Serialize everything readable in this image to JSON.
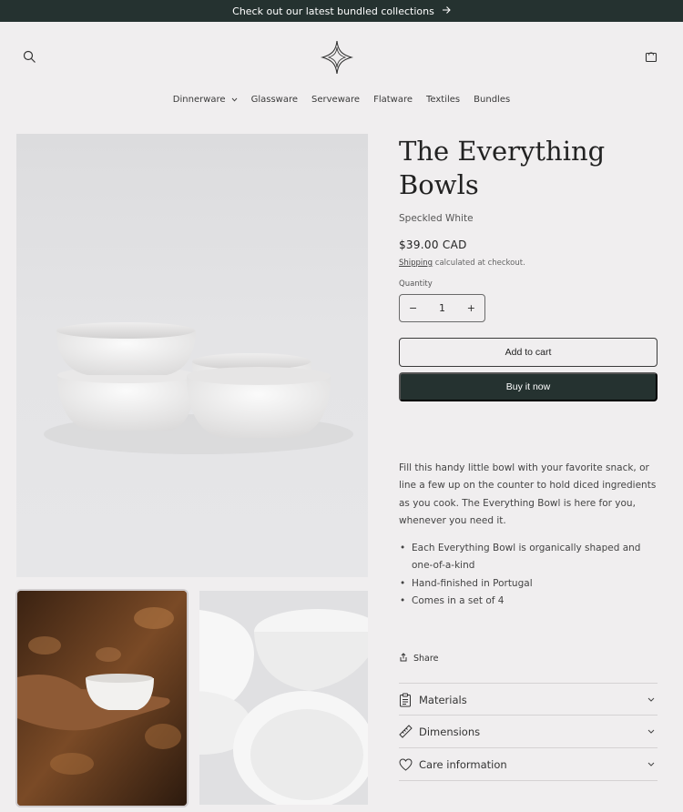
{
  "announcement": {
    "text": "Check out our latest bundled collections",
    "arrow_icon": "arrow-right-icon"
  },
  "header": {
    "search_icon": "search-icon",
    "logo_icon": "star-logo-icon",
    "cart_icon": "cart-icon"
  },
  "nav": {
    "items": [
      {
        "label": "Dinnerware",
        "has_dropdown": true
      },
      {
        "label": "Glassware"
      },
      {
        "label": "Serveware"
      },
      {
        "label": "Flatware"
      },
      {
        "label": "Textiles"
      },
      {
        "label": "Bundles"
      }
    ]
  },
  "product": {
    "title": "The Everything Bowls",
    "variant": "Speckled White",
    "price": "$39.00 CAD",
    "shipping_link": "Shipping",
    "shipping_suffix": " calculated at checkout.",
    "quantity_label": "Quantity",
    "quantity_value": "1",
    "minus": "−",
    "plus": "+",
    "add_to_cart": "Add to cart",
    "buy_now": "Buy it now",
    "description": "Fill this handy little bowl with your favorite snack, or line a few up on the counter to hold diced ingredients as you cook. The Everything Bowl is here for you, whenever you need it.",
    "bullets": [
      "Each Everything Bowl is organically shaped and one-of-a-kind",
      "Hand-finished in Portugal",
      "Comes in a set of 4"
    ],
    "share": "Share"
  },
  "accordions": [
    {
      "label": "Materials",
      "icon": "clipboard-icon"
    },
    {
      "label": "Dimensions",
      "icon": "ruler-icon"
    },
    {
      "label": "Care information",
      "icon": "heart-icon"
    }
  ],
  "colors": {
    "dark": "#253230",
    "background": "#f0eeef"
  }
}
